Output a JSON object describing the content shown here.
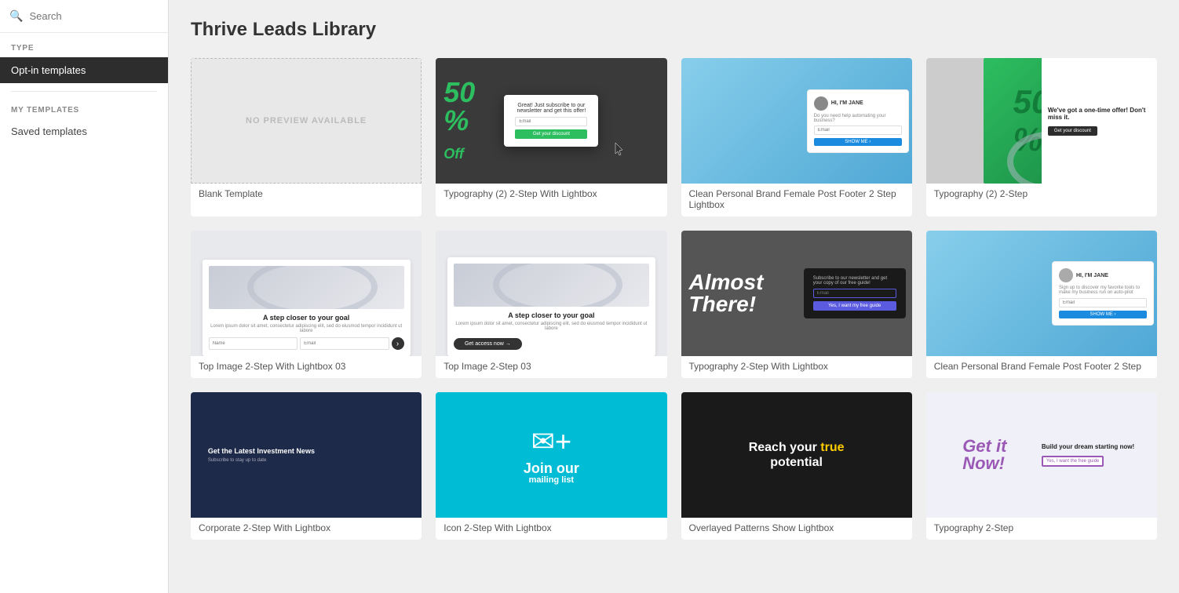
{
  "sidebar": {
    "search_placeholder": "Search",
    "type_label": "TYPE",
    "opt_in_label": "Opt-in templates",
    "my_templates_label": "MY TEMPLATES",
    "saved_templates_label": "Saved templates"
  },
  "main": {
    "title": "Thrive Leads Library",
    "templates": [
      {
        "id": "blank",
        "label": "Blank Template",
        "col": 1,
        "row": 1
      },
      {
        "id": "typo2step-lightbox",
        "label": "Typography (2) 2-Step With Lightbox",
        "col": 2,
        "row": 1
      },
      {
        "id": "cpb-post-footer-2step",
        "label": "Clean Personal Brand Female Post Footer 2 Step Lightbox",
        "col": 3,
        "row": 1
      },
      {
        "id": "typo2step-sm",
        "label": "Typography (2) 2-Step",
        "col": 4,
        "row": 1
      },
      {
        "id": "topimg-2step-lightbox-03",
        "label": "Top Image 2-Step With Lightbox 03",
        "col": 1,
        "row": 2
      },
      {
        "id": "topimg-2step-03",
        "label": "Top Image 2-Step 03",
        "col": 2,
        "row": 2
      },
      {
        "id": "typo-2step-lightbox",
        "label": "Typography 2-Step With Lightbox",
        "col": 3,
        "row": 2
      },
      {
        "id": "cpb-post-footer-2step-sm",
        "label": "Clean Personal Brand Female Post Footer 2 Step",
        "col": 4,
        "row": 2
      },
      {
        "id": "corporate-2step-lightbox",
        "label": "Corporate 2-Step With Lightbox",
        "col": 1,
        "row": 3
      },
      {
        "id": "icon-2step-lightbox",
        "label": "Icon 2-Step With Lightbox",
        "col": 2,
        "row": 3
      },
      {
        "id": "overlay-patterns-lightbox",
        "label": "Overlayed Patterns Show Lightbox",
        "col": 3,
        "row": 3
      },
      {
        "id": "typo2step-sm2",
        "label": "Typography 2-Step",
        "col": 4,
        "row": 3
      }
    ],
    "template_texts": {
      "no_preview": "NO PREVIEW AVAILABLE",
      "step_closer": "A step closer to your goal",
      "lorem": "Lorem ipsum dolor sit amet, consectetur adipiscing elit, sed do eiusmod tempor",
      "get_access": "Get access now →",
      "fifty_off": "50% Off",
      "dont_miss": "We've got a one-time offer! Don't miss it.",
      "get_discount": "Get your discount",
      "hi_jane": "HI, I'M JANE",
      "do_you_need": "Do you need help automating your business?",
      "show_me": "SHOW ME",
      "almost_there": "Almost There!",
      "subscribe_copy": "Subscribe to our newsletter and get your copy of our free guide!",
      "yes_want": "Yes, I want my free guide",
      "join_mailing": "Join our mailing list",
      "reach_potential": "Reach your true potential",
      "get_latest": "Get the Latest Investment News",
      "get_it_now": "Get it Now!",
      "build_dream": "Build your dream starting now!",
      "yes_want_free": "Yes, I want the free guide"
    }
  }
}
